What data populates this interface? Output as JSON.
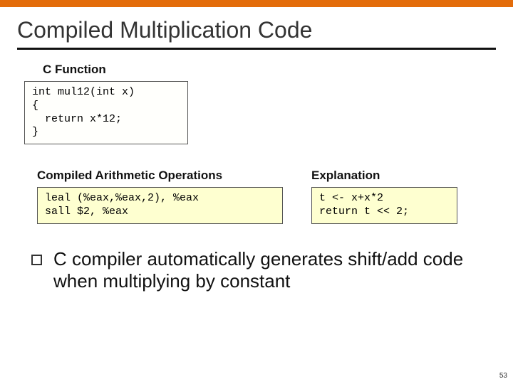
{
  "title": "Compiled Multiplication Code",
  "c_label": "C Function",
  "c_code": "int mul12(int x)\n{\n  return x*12;\n}",
  "asm_label": "Compiled Arithmetic Operations",
  "asm_code": "leal (%eax,%eax,2), %eax\nsall $2, %eax",
  "exp_label": "Explanation",
  "exp_code": "t <- x+x*2\nreturn t << 2;",
  "bullet": "C compiler automatically generates shift/add code when multiplying by constant",
  "page_number": "53"
}
